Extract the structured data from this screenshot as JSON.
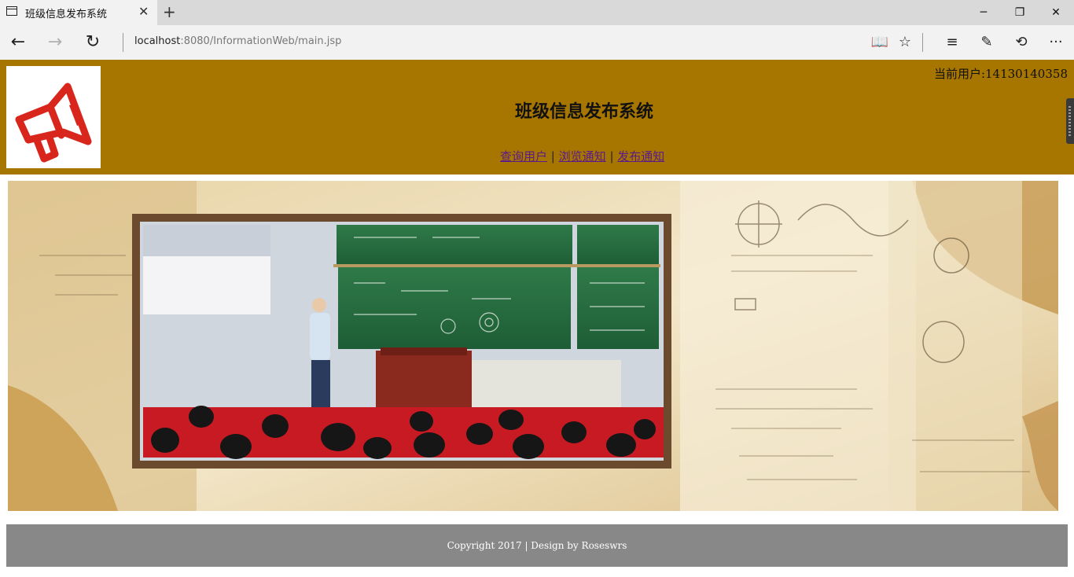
{
  "browser": {
    "tab_title": "班级信息发布系统",
    "tab_close": "✕",
    "new_tab": "+",
    "url_host": "localhost",
    "url_rest": ":8080/InformationWeb/main.jsp",
    "window_controls": {
      "minimize": "─",
      "restore": "❐",
      "close": "✕"
    },
    "nav": {
      "back": "←",
      "forward": "→",
      "refresh": "↻"
    },
    "tools": {
      "reading_view": "📖",
      "favorite": "☆",
      "hub": "≡",
      "notes": "✎",
      "share": "⟲",
      "more": "···"
    }
  },
  "header": {
    "current_user": "当前用户:14130140358",
    "title": "班级信息发布系统",
    "nav": [
      {
        "label": "查询用户"
      },
      {
        "label": "浏览通知"
      },
      {
        "label": "发布通知"
      }
    ],
    "nav_separator": "|",
    "colors": {
      "header_bg": "#a77600",
      "link": "#5a1a8a",
      "logo_red": "#d8261c"
    }
  },
  "footer": {
    "text": "Copyright 2017 | Design by Roseswrs",
    "bg": "#888888"
  },
  "icons": {
    "logo": "megaphone-icon"
  }
}
